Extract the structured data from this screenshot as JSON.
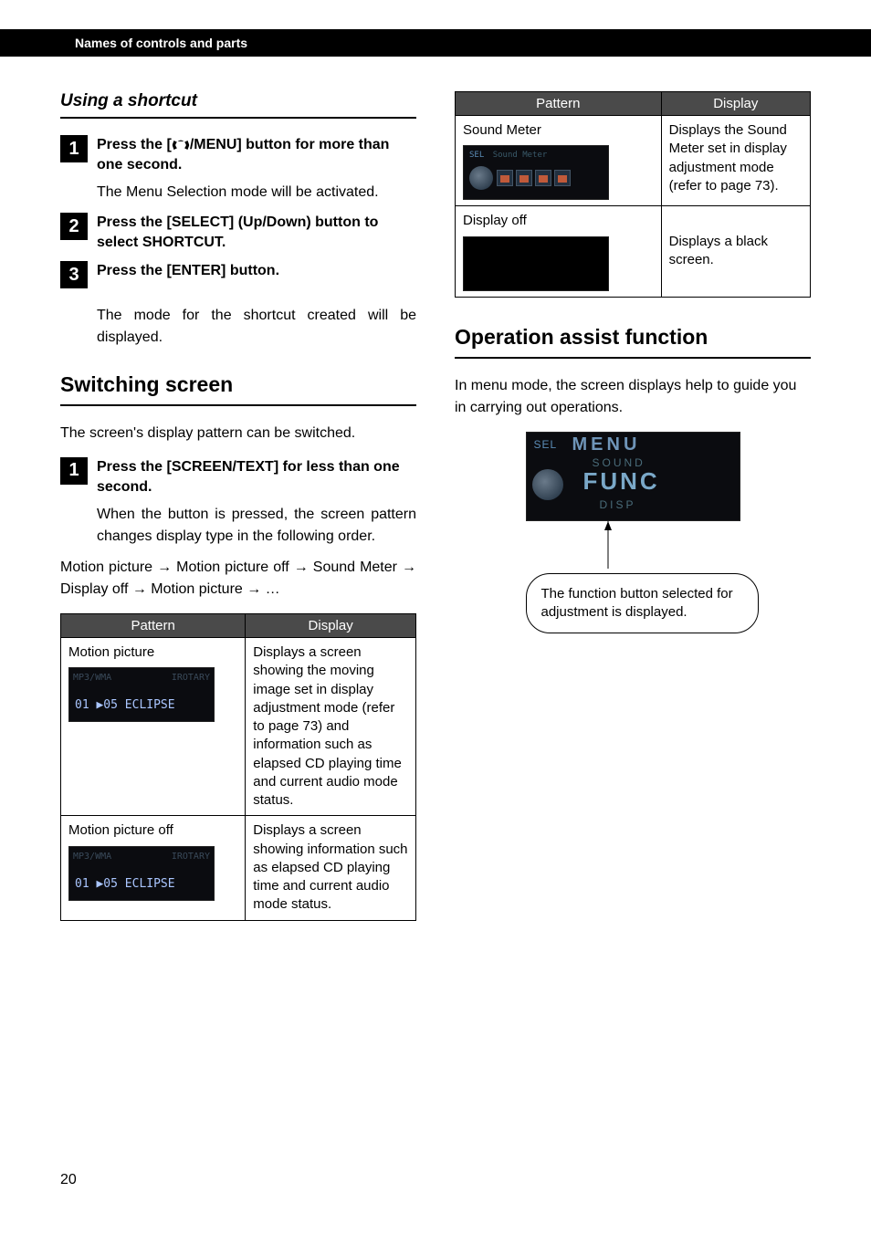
{
  "header": {
    "section_title": "Names of controls and parts"
  },
  "left": {
    "subtitle": "Using a shortcut",
    "steps": [
      {
        "num": "1",
        "head_prefix": "Press the [",
        "head_suffix": "/MENU] button for more than one second.",
        "text": "The Menu Selection mode will be activated."
      },
      {
        "num": "2",
        "head": "Press the [SELECT] (Up/Down) button to select SHORTCUT.",
        "text": ""
      },
      {
        "num": "3",
        "head": "Press the [ENTER] button.",
        "text": "The mode for the shortcut created will be displayed."
      }
    ],
    "switching_title": "Switching screen",
    "switching_intro": "The screen's display pattern can be switched.",
    "switching_step": {
      "num": "1",
      "head": "Press the [SCREEN/TEXT] for less than one second.",
      "text": "When the button is pressed, the screen pattern changes display type in the following order."
    },
    "order_line": "Motion picture → Motion picture off → Sound Meter → Display off → Motion picture → …",
    "table_headers": {
      "pattern": "Pattern",
      "display": "Display"
    },
    "table_rows": [
      {
        "pattern_label": "Motion picture",
        "lcd": {
          "type": "motion",
          "lines": [
            "MP3/WMA",
            "01  ▶05 ECLIPSE",
            "IROTARY"
          ]
        },
        "display_text": "Displays a screen showing the moving image set in display adjustment mode (refer to page 73) and information such as elapsed CD playing time and current audio mode status."
      },
      {
        "pattern_label": "Motion picture off",
        "lcd": {
          "type": "motion_off",
          "lines": [
            "MP3/WMA",
            "01  ▶05 ECLIPSE",
            "IROTARY"
          ]
        },
        "display_text": "Displays a screen showing information such as elapsed CD playing time and current audio mode status."
      }
    ]
  },
  "right": {
    "table_rows": [
      {
        "pattern_label": "Sound Meter",
        "lcd": {
          "type": "soundmeter",
          "title": "Sound Meter",
          "sel": "SEL"
        },
        "display_text": "Displays the Sound Meter set in display adjustment mode (refer to page 73)."
      },
      {
        "pattern_label": "Display off",
        "lcd": {
          "type": "blank"
        },
        "display_text": "Displays a black screen."
      }
    ],
    "assist_title": "Operation assist function",
    "assist_intro": "In menu mode, the screen displays help to guide you in carrying out operations.",
    "big_lcd": {
      "sel": "SEL",
      "menu": "MENU",
      "sound": "SOUND",
      "func": "FUNC",
      "disp": "DISP"
    },
    "callout": "The function button selected for adjustment is displayed."
  },
  "page_number": "20"
}
